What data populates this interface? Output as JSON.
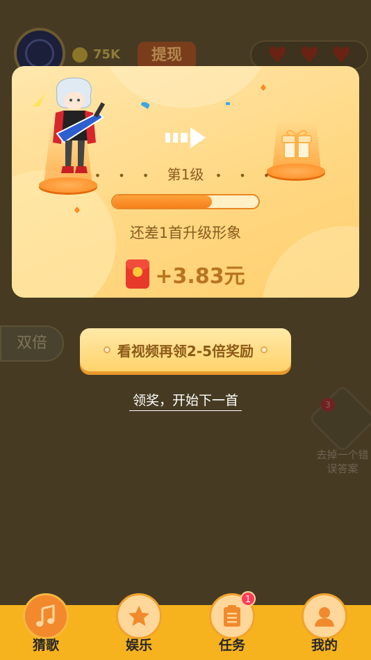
{
  "background": {
    "coins": "75K",
    "withdraw_label": "提现",
    "double_label": "双倍",
    "hint_badge": "3",
    "hint_text": "去掉一个错误答案"
  },
  "modal": {
    "level_label": "第1级",
    "level_dots": "• • •",
    "progress_fraction": 0.68,
    "need_text": "还差1首升级形象",
    "reward_text": "+3.83元"
  },
  "actions": {
    "video_button_label": "看视频再领2-5倍奖励",
    "next_link_label": "领奖，开始下一首"
  },
  "nav": {
    "items": [
      {
        "label": "猜歌",
        "icon": "music-note-icon",
        "active": true
      },
      {
        "label": "娱乐",
        "icon": "star-icon",
        "active": false
      },
      {
        "label": "任务",
        "icon": "task-list-icon",
        "active": false,
        "badge": "1"
      },
      {
        "label": "我的",
        "icon": "person-icon",
        "active": false
      }
    ]
  },
  "colors": {
    "accent": "#f6801a",
    "nav_bg": "#f6b31e",
    "badge": "#ff3b55",
    "card": "#ffd884"
  }
}
